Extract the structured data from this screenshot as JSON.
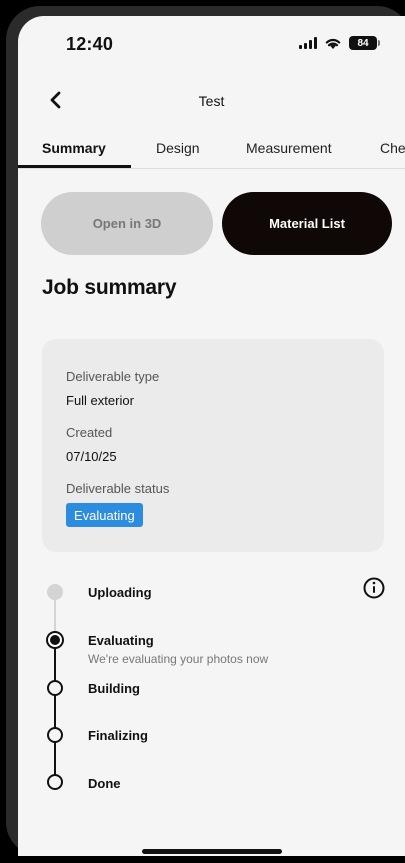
{
  "status_bar": {
    "time": "12:40",
    "battery": "84"
  },
  "nav": {
    "title": "Test"
  },
  "tabs": [
    {
      "label": "Summary",
      "active": true
    },
    {
      "label": "Design",
      "active": false
    },
    {
      "label": "Measurement",
      "active": false
    },
    {
      "label": "Che",
      "active": false
    }
  ],
  "actions": {
    "open_3d": "Open in 3D",
    "material_list": "Material List"
  },
  "job_summary": {
    "title": "Job summary",
    "deliverable_type_label": "Deliverable type",
    "deliverable_type_value": "Full exterior",
    "created_label": "Created",
    "created_value": "07/10/25",
    "deliverable_status_label": "Deliverable status",
    "deliverable_status_value": "Evaluating"
  },
  "timeline": [
    {
      "label": "Uploading",
      "state": "done"
    },
    {
      "label": "Evaluating",
      "state": "current",
      "description": "We're evaluating your photos now"
    },
    {
      "label": "Building",
      "state": "pending"
    },
    {
      "label": "Finalizing",
      "state": "pending"
    },
    {
      "label": "Done",
      "state": "pending"
    }
  ],
  "colors": {
    "accent_blue": "#2b8ce0",
    "primary_dark": "#100707",
    "disabled_gray": "#cfcfcf"
  },
  "icons": {
    "back": "chevron-left-icon",
    "info": "info-circle-icon",
    "wifi": "wifi-icon",
    "signal": "signal-icon",
    "battery": "battery-icon"
  }
}
